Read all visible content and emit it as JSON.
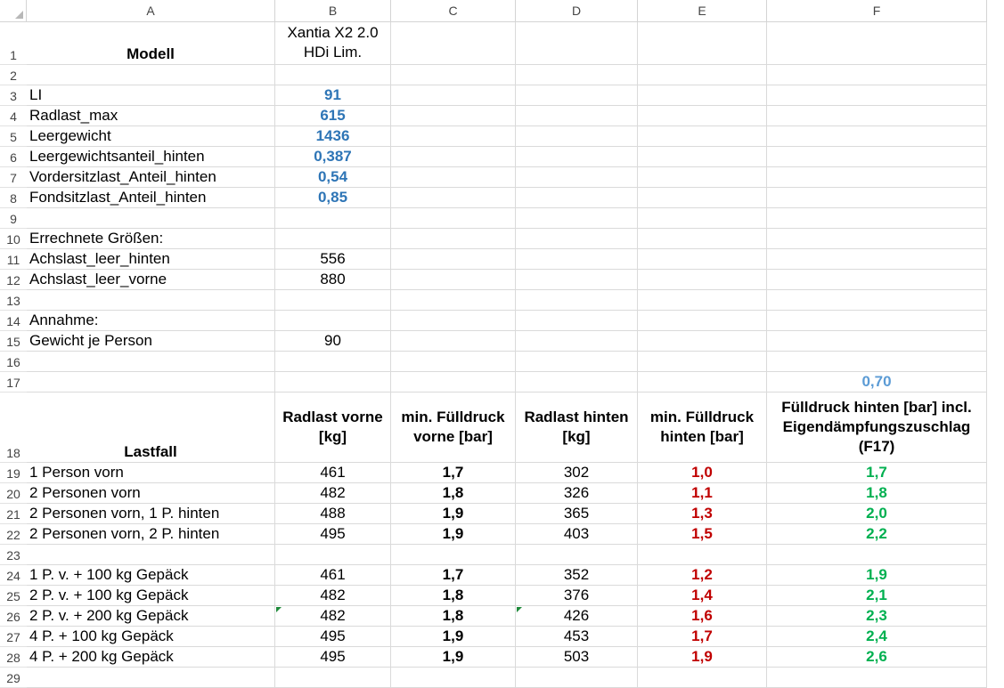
{
  "columns": [
    "A",
    "B",
    "C",
    "D",
    "E",
    "F"
  ],
  "rows": {
    "r1": {
      "num": "1",
      "a": "Modell",
      "b": "Xantia X2 2.0 HDi Lim."
    },
    "r2": {
      "num": "2"
    },
    "r3": {
      "num": "3",
      "a": "LI",
      "b": "91"
    },
    "r4": {
      "num": "4",
      "a": "Radlast_max",
      "b": "615"
    },
    "r5": {
      "num": "5",
      "a": "Leergewicht",
      "b": "1436"
    },
    "r6": {
      "num": "6",
      "a": "Leergewichtsanteil_hinten",
      "b": "0,387"
    },
    "r7": {
      "num": "7",
      "a": "Vordersitzlast_Anteil_hinten",
      "b": "0,54"
    },
    "r8": {
      "num": "8",
      "a": "Fondsitzlast_Anteil_hinten",
      "b": "0,85"
    },
    "r9": {
      "num": "9"
    },
    "r10": {
      "num": "10",
      "a": "Errechnete Größen:"
    },
    "r11": {
      "num": "11",
      "a": "Achslast_leer_hinten",
      "b": "556"
    },
    "r12": {
      "num": "12",
      "a": "Achslast_leer_vorne",
      "b": "880"
    },
    "r13": {
      "num": "13"
    },
    "r14": {
      "num": "14",
      "a": "Annahme:"
    },
    "r15": {
      "num": "15",
      "a": "Gewicht je Person",
      "b": "90"
    },
    "r16": {
      "num": "16"
    },
    "r17": {
      "num": "17",
      "f": "0,70"
    },
    "r18": {
      "num": "18",
      "a": "Lastfall",
      "b": "Radlast vorne [kg]",
      "c": "min. Fülldruck vorne [bar]",
      "d": "Radlast hinten [kg]",
      "e": "min. Fülldruck hinten [bar]",
      "f": "Fülldruck hinten [bar] incl. Eigendämpfungszuschlag (F17)"
    },
    "r19": {
      "num": "19",
      "a": "1 Person vorn",
      "b": "461",
      "c": "1,7",
      "d": "302",
      "e": "1,0",
      "f": "1,7"
    },
    "r20": {
      "num": "20",
      "a": "2 Personen vorn",
      "b": "482",
      "c": "1,8",
      "d": "326",
      "e": "1,1",
      "f": "1,8"
    },
    "r21": {
      "num": "21",
      "a": "2 Personen vorn, 1 P. hinten",
      "b": "488",
      "c": "1,9",
      "d": "365",
      "e": "1,3",
      "f": "2,0"
    },
    "r22": {
      "num": "22",
      "a": "2 Personen vorn, 2 P. hinten",
      "b": "495",
      "c": "1,9",
      "d": "403",
      "e": "1,5",
      "f": "2,2"
    },
    "r23": {
      "num": "23"
    },
    "r24": {
      "num": "24",
      "a": "1 P. v. + 100 kg Gepäck",
      "b": "461",
      "c": "1,7",
      "d": "352",
      "e": "1,2",
      "f": "1,9"
    },
    "r25": {
      "num": "25",
      "a": "2 P. v. + 100 kg Gepäck",
      "b": "482",
      "c": "1,8",
      "d": "376",
      "e": "1,4",
      "f": "2,1"
    },
    "r26": {
      "num": "26",
      "a": "2 P. v. + 200 kg Gepäck",
      "b": "482",
      "c": "1,8",
      "d": "426",
      "e": "1,6",
      "f": "2,3"
    },
    "r27": {
      "num": "27",
      "a": "4 P. + 100 kg Gepäck",
      "b": "495",
      "c": "1,9",
      "d": "453",
      "e": "1,7",
      "f": "2,4"
    },
    "r28": {
      "num": "28",
      "a": "4 P. + 200 kg Gepäck",
      "b": "495",
      "c": "1,9",
      "d": "503",
      "e": "1,9",
      "f": "2,6"
    },
    "r29": {
      "num": "29"
    }
  },
  "colors": {
    "input_blue": "#2e75b6",
    "rear_red": "#c00000",
    "rear_green": "#00b050",
    "grid": "#dadada"
  }
}
